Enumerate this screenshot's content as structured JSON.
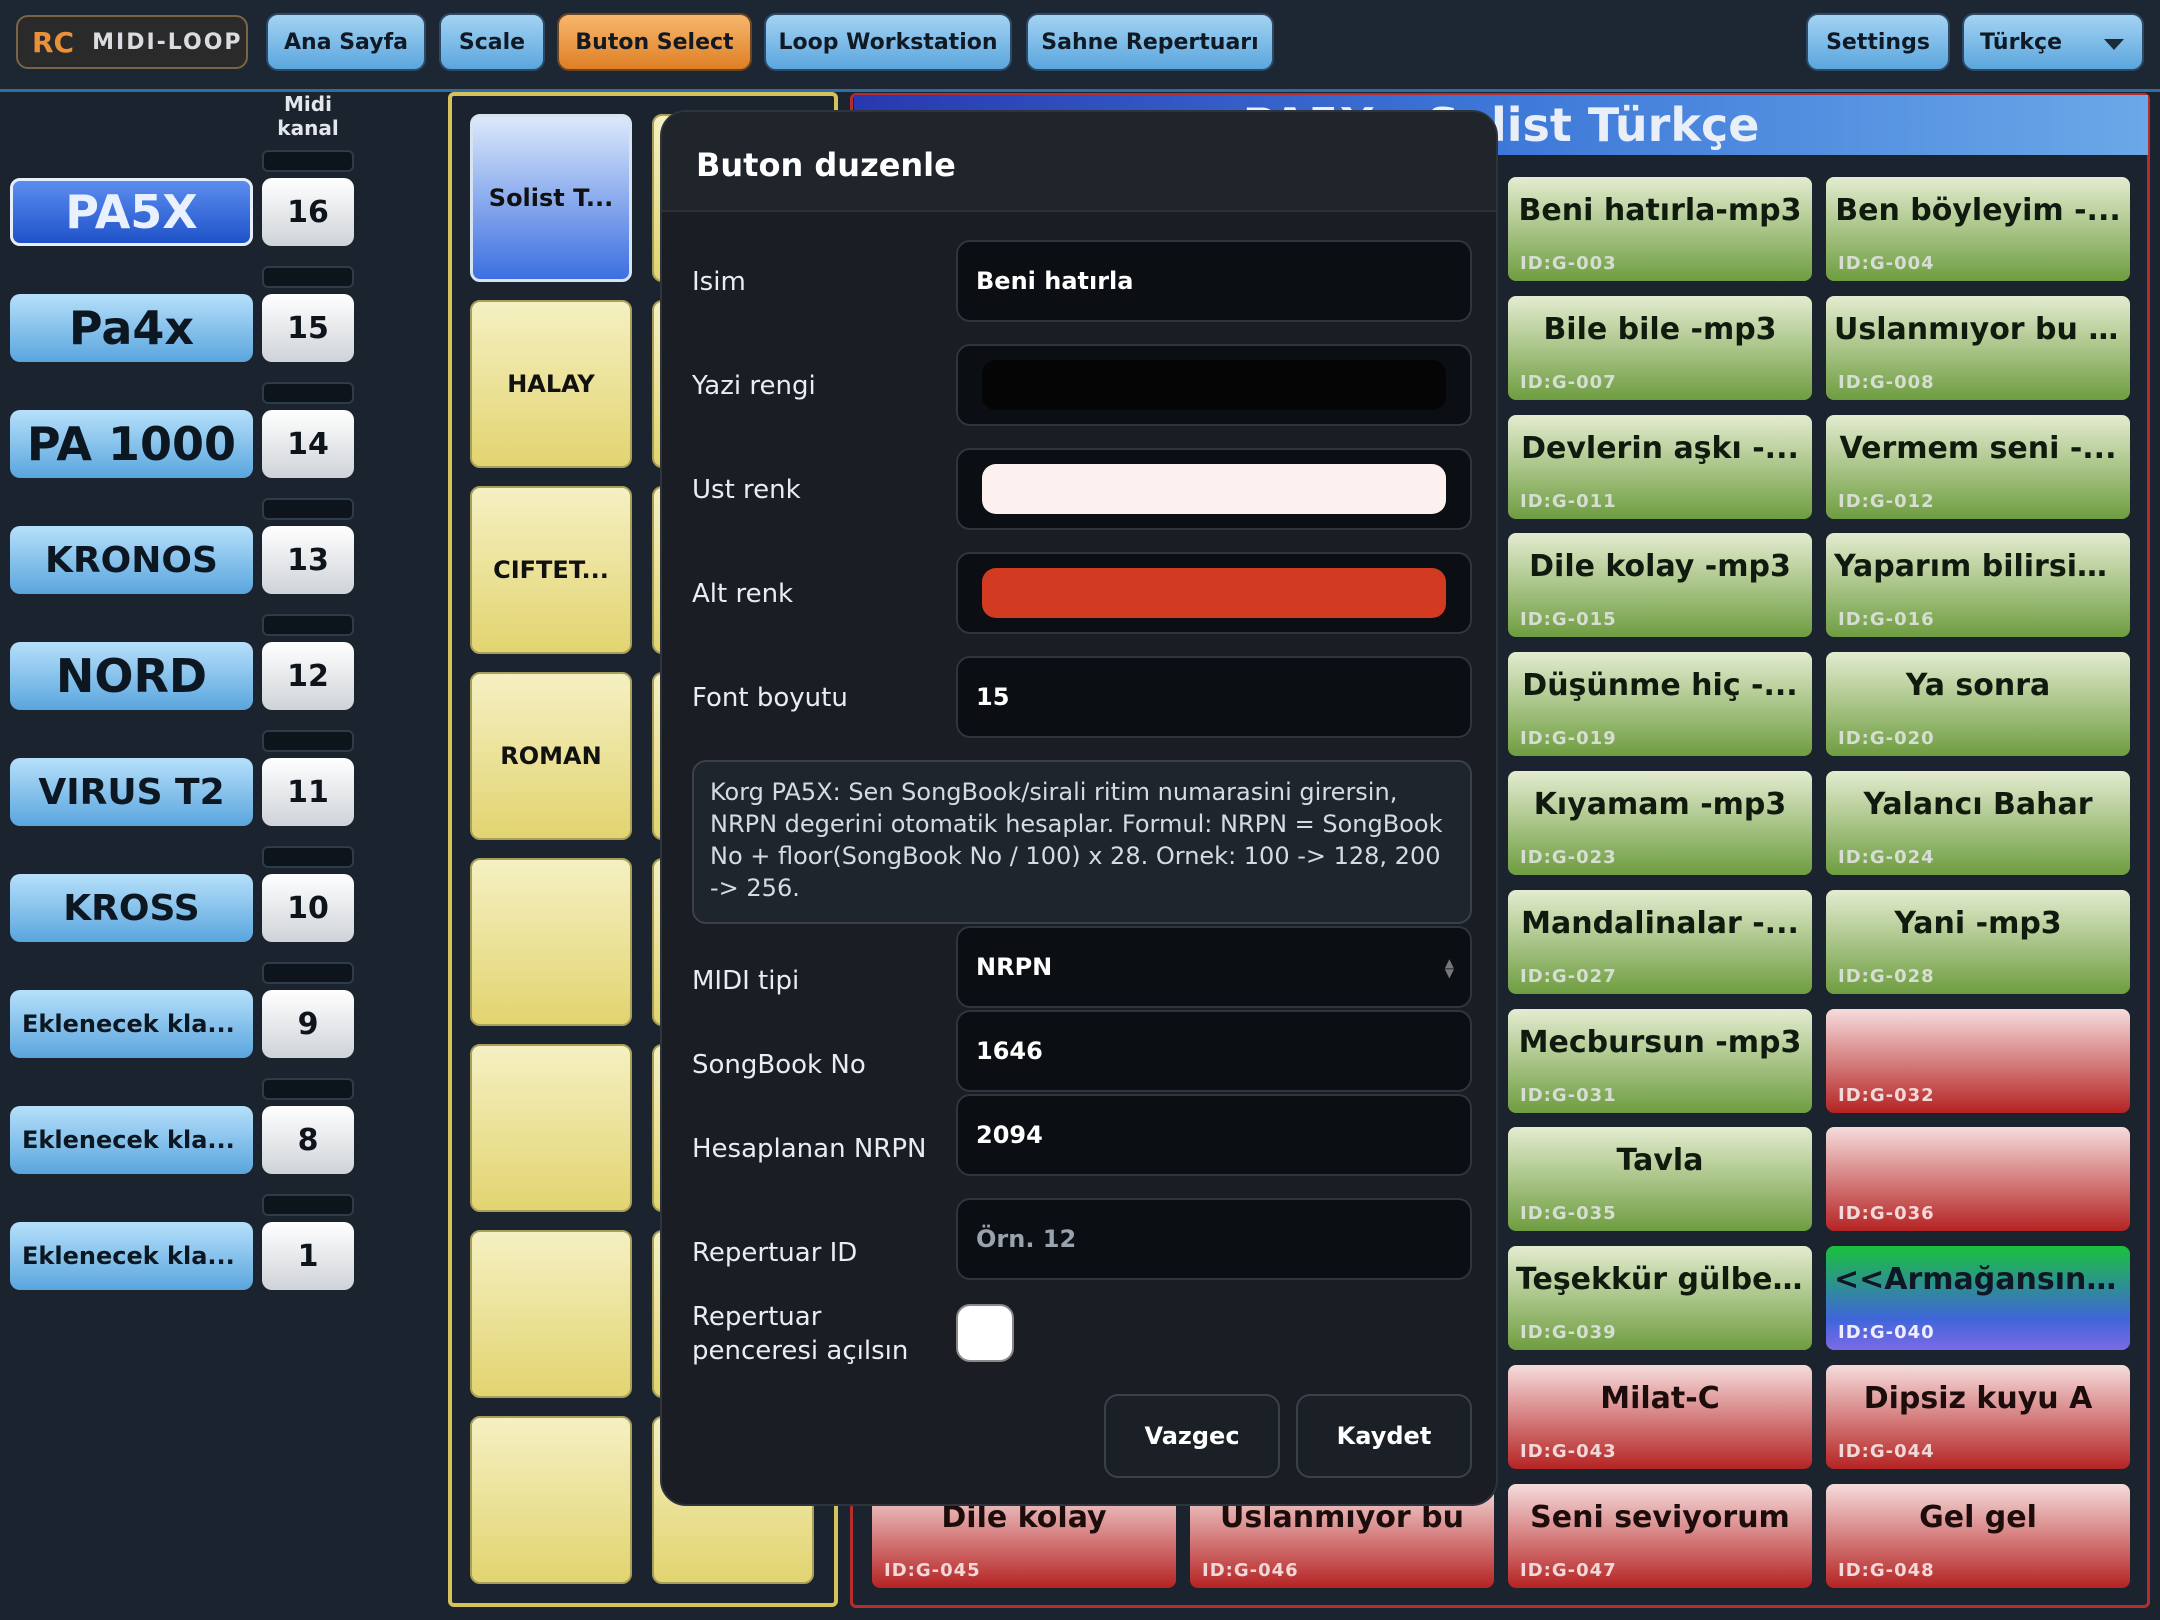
{
  "app": {
    "logo_rc": "RC",
    "logo_name": "MIDI-LOOP"
  },
  "nav": {
    "items": [
      {
        "label": "Ana Sayfa"
      },
      {
        "label": "Scale"
      },
      {
        "label": "Buton Select",
        "active": true
      },
      {
        "label": "Loop Workstation"
      },
      {
        "label": "Sahne Repertuarı"
      }
    ],
    "settings": "Settings",
    "language": "Türkçe"
  },
  "sidebar": {
    "header": "Midi kanal",
    "devices": [
      {
        "name": "PA5X",
        "channel": "16",
        "selected": true
      },
      {
        "name": "Pa4x",
        "channel": "15"
      },
      {
        "name": "PA 1000",
        "channel": "14"
      },
      {
        "name": "KRONOS",
        "channel": "13"
      },
      {
        "name": "NORD",
        "channel": "12"
      },
      {
        "name": "VIRUS T2",
        "channel": "11"
      },
      {
        "name": "KROSS",
        "channel": "10"
      },
      {
        "name": "Eklenecek kla...",
        "channel": "9"
      },
      {
        "name": "Eklenecek kla...",
        "channel": "8"
      },
      {
        "name": "Eklenecek kla...",
        "channel": "1"
      }
    ]
  },
  "categories": [
    "Solist T...",
    "HALAY",
    "CIFTET...",
    "ROMAN",
    "",
    "",
    "",
    ""
  ],
  "grid": {
    "title": "PA5X - Solist Türkçe",
    "buttons": [
      {
        "label": "Beni hatırla-mp3",
        "id": "ID:G-003",
        "color": "green"
      },
      {
        "label": "Ben böyleyim -...",
        "id": "ID:G-004",
        "color": "green"
      },
      {
        "label": "Bile bile -mp3",
        "id": "ID:G-007",
        "color": "green"
      },
      {
        "label": "Uslanmıyor bu -...",
        "id": "ID:G-008",
        "color": "green"
      },
      {
        "label": "Devlerin aşkı -...",
        "id": "ID:G-011",
        "color": "green"
      },
      {
        "label": "Vermem seni -...",
        "id": "ID:G-012",
        "color": "green"
      },
      {
        "label": "Dile kolay -mp3",
        "id": "ID:G-015",
        "color": "green"
      },
      {
        "label": "Yaparım bilirsin...",
        "id": "ID:G-016",
        "color": "green"
      },
      {
        "label": "Düşünme hiç -...",
        "id": "ID:G-019",
        "color": "green"
      },
      {
        "label": "Ya sonra",
        "id": "ID:G-020",
        "color": "green"
      },
      {
        "label": "Kıyamam -mp3",
        "id": "ID:G-023",
        "color": "green"
      },
      {
        "label": "Yalancı Bahar",
        "id": "ID:G-024",
        "color": "green"
      },
      {
        "label": "Mandalinalar -...",
        "id": "ID:G-027",
        "color": "green"
      },
      {
        "label": "Yani -mp3",
        "id": "ID:G-028",
        "color": "green"
      },
      {
        "label": "Mecbursun -mp3",
        "id": "ID:G-031",
        "color": "green"
      },
      {
        "label": "",
        "id": "ID:G-032",
        "color": "red"
      },
      {
        "label": "Tavla",
        "id": "ID:G-035",
        "color": "green"
      },
      {
        "label": "",
        "id": "ID:G-036",
        "color": "red"
      },
      {
        "label": "Teşekkür gülbe...",
        "id": "ID:G-039",
        "color": "green"
      },
      {
        "label": "<<Armağansın>>",
        "id": "ID:G-040",
        "color": "bright"
      },
      {
        "label": "Milat-C",
        "id": "ID:G-043",
        "color": "red"
      },
      {
        "label": "Dipsiz kuyu A",
        "id": "ID:G-044",
        "color": "red"
      },
      {
        "label": "Seni seviyorum",
        "id": "ID:G-047",
        "color": "red"
      },
      {
        "label": "Gel gel",
        "id": "ID:G-048",
        "color": "red"
      }
    ],
    "bottom_row": [
      {
        "label": "Dile kolay",
        "id": "ID:G-045",
        "color": "red"
      },
      {
        "label": "Uslanmıyor bu",
        "id": "ID:G-046",
        "color": "red"
      }
    ]
  },
  "modal": {
    "title": "Buton duzenle",
    "name_label": "Isim",
    "name_value": "Beni hatırla",
    "text_color_label": "Yazi rengi",
    "text_color": "#050505",
    "top_color_label": "Ust renk",
    "top_color": "#fdf1ef",
    "bottom_color_label": "Alt renk",
    "bottom_color": "#d23a22",
    "font_size_label": "Font boyutu",
    "font_size_value": "15",
    "help_text": "Korg PA5X: Sen SongBook/sirali ritim numarasini girersin, NRPN degerini otomatik hesaplar. Formul: NRPN = SongBook No + floor(SongBook No / 100) x 28. Ornek: 100 -> 128, 200 -> 256.",
    "midi_type_label": "MIDI tipi",
    "midi_type_value": "NRPN",
    "songbook_label": "SongBook No",
    "songbook_value": "1646",
    "nrpn_label": "Hesaplanan NRPN",
    "nrpn_value": "2094",
    "repertuar_label": "Repertuar ID",
    "repertuar_placeholder": "Örn. 12",
    "open_window_label": "Repertuar penceresi açılsın",
    "open_window_checked": false,
    "cancel": "Vazgec",
    "save": "Kaydet"
  }
}
